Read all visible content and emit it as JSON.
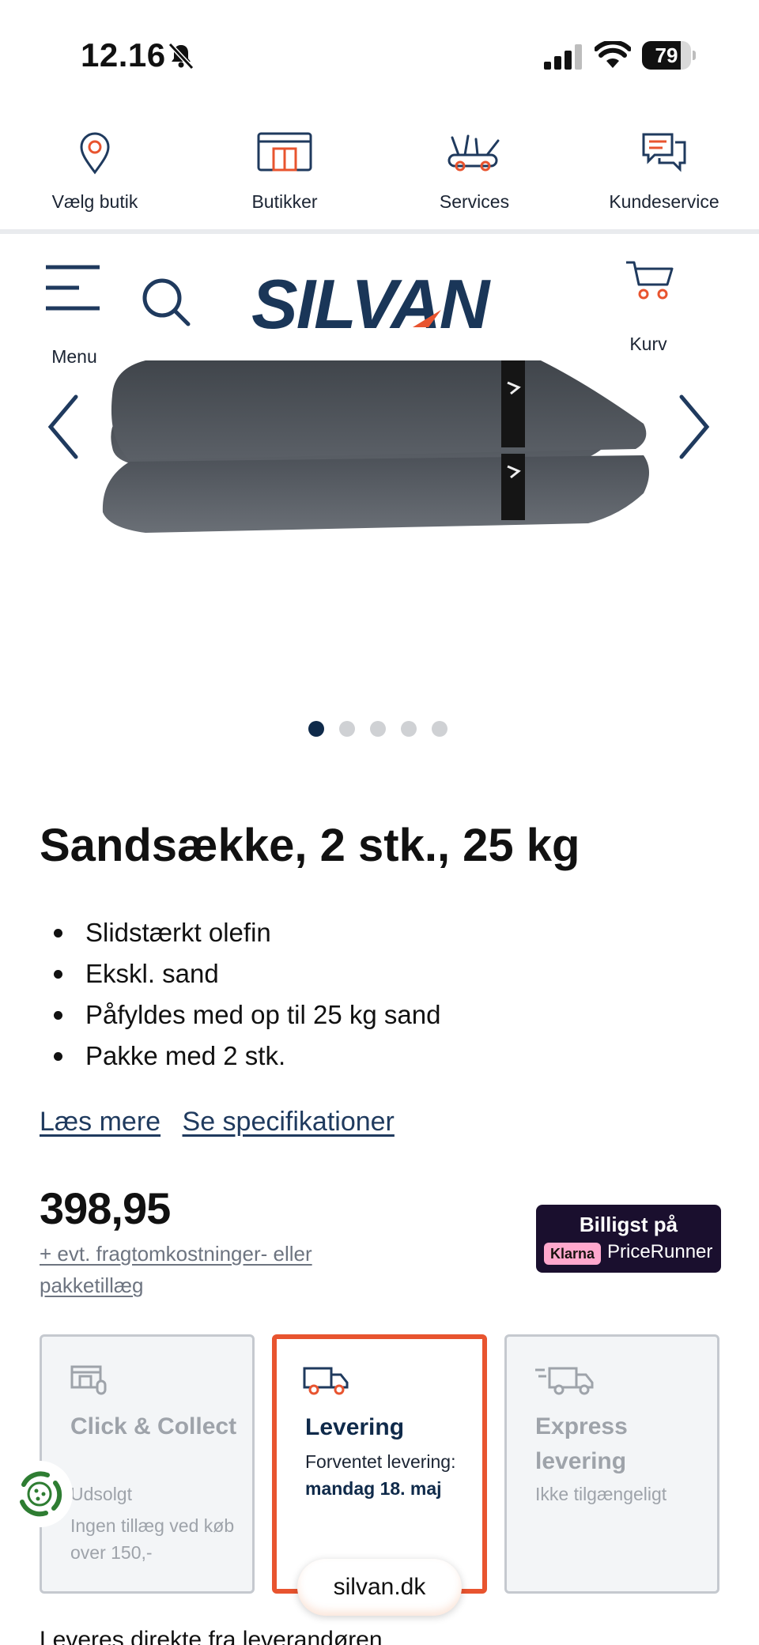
{
  "status_bar": {
    "time": "12.16",
    "battery": "79",
    "battery_fraction": 0.79
  },
  "top_nav": [
    {
      "label": "Vælg butik",
      "icon": "location-pin-icon"
    },
    {
      "label": "Butikker",
      "icon": "store-icon"
    },
    {
      "label": "Services",
      "icon": "tools-icon"
    },
    {
      "label": "Kundeservice",
      "icon": "chat-bubbles-icon"
    }
  ],
  "header": {
    "menu_label": "Menu",
    "logo": "SILVAN",
    "cart_label": "Kurv"
  },
  "gallery": {
    "slide_count": 5,
    "active_slide": 1
  },
  "product": {
    "title": "Sandsække, 2 stk., 25 kg",
    "features": [
      "Slidstærkt olefin",
      "Ekskl. sand",
      "Påfyldes med op til 25 kg sand",
      "Pakke med 2 stk."
    ],
    "read_more": "Læs mere",
    "specifications": "Se specifikationer",
    "price": "398,95",
    "shipping_note": "+ evt. fragtomkostninger- eller pakketillæg"
  },
  "pricerunner": {
    "top": "Billigst på",
    "klarna": "Klarna",
    "name": "PriceRunner"
  },
  "delivery": {
    "click_collect": {
      "title": "Click & Collect",
      "status": "Udsolgt",
      "note": "Ingen tillæg ved køb over 150,-"
    },
    "levering": {
      "title": "Levering",
      "prefix": "Forventet levering: ",
      "date": "mandag 18. maj"
    },
    "express": {
      "title": "Express levering",
      "status": "Ikke tilgængeligt"
    }
  },
  "browser": {
    "url": "silvan.dk"
  },
  "bottom_note": "Leveres direkte fra leverandøren",
  "colors": {
    "brand_navy": "#1a3658",
    "accent_orange": "#e8542f"
  }
}
